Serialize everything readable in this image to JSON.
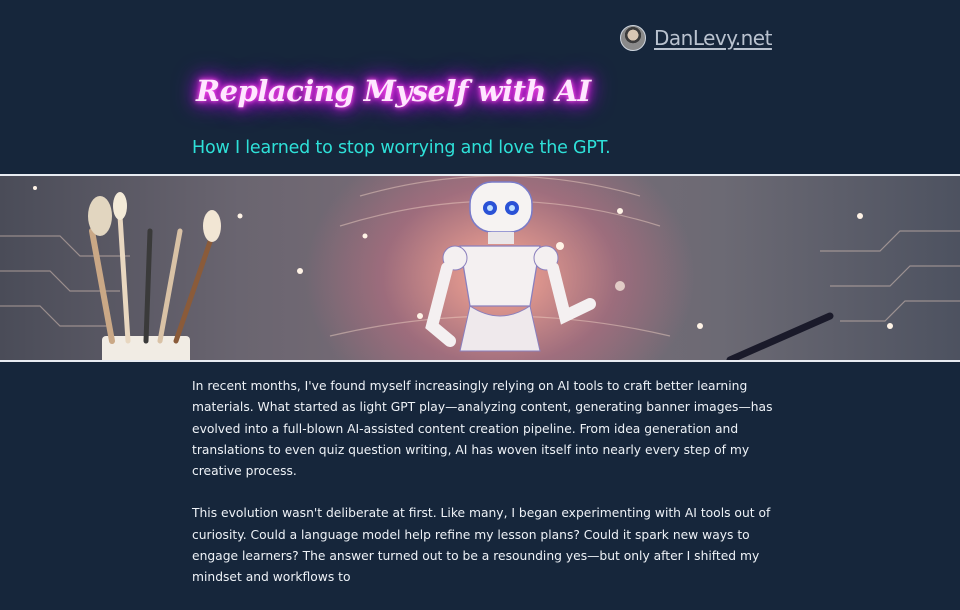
{
  "header": {
    "site_name": "DanLevy.net"
  },
  "article": {
    "title": "Replacing Myself with AI",
    "subtitle": "How I learned to stop worrying and love the GPT.",
    "banner_icon": "robot-with-paintbrushes-illustration",
    "paragraphs": [
      "In recent months, I've found myself increasingly relying on AI tools to craft better learning materials. What started as light GPT play—analyzing content, generating banner images—has evolved into a full-blown AI-assisted content creation pipeline. From idea generation and translations to even quiz question writing, AI has woven itself into nearly every step of my creative process.",
      "This evolution wasn't deliberate at first. Like many, I began experimenting with AI tools out of curiosity. Could a language model help refine my lesson plans? Could it spark new ways to engage learners? The answer turned out to be a resounding yes—but only after I shifted my mindset and workflows to"
    ]
  },
  "colors": {
    "background": "#16263b",
    "title_glow": "#ff2ee6",
    "subtitle": "#2ee0d8",
    "link": "#b9c2cf"
  }
}
